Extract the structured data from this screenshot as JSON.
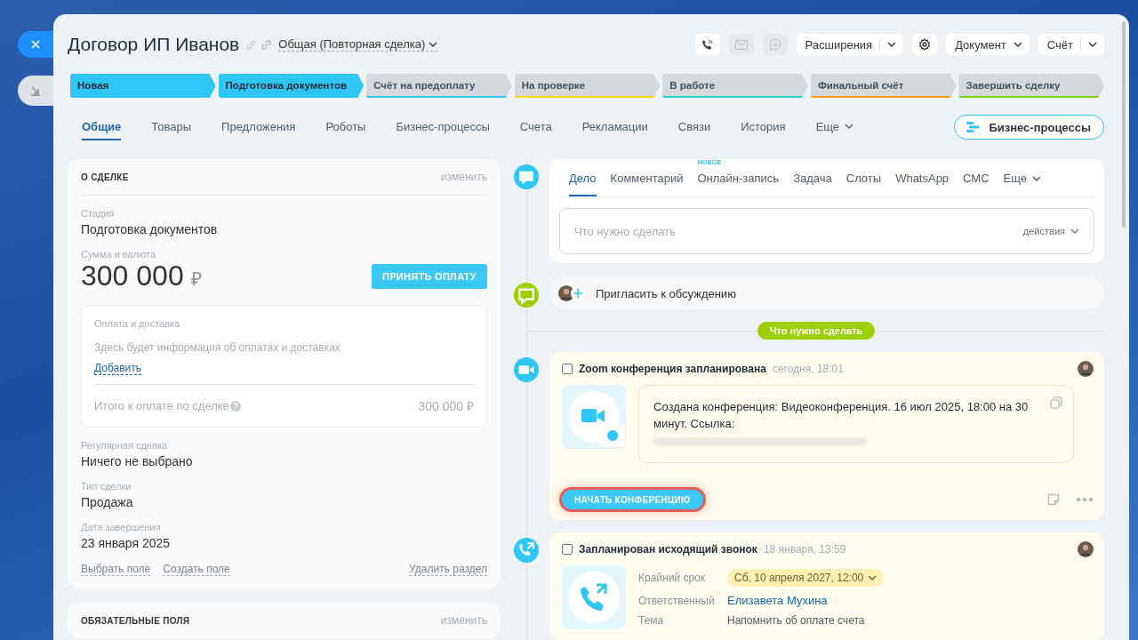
{
  "header": {
    "title": "Договор ИП Иванов",
    "category": "Общая (Повторная сделка)",
    "icon_buttons": [
      {
        "kind": "phone",
        "disabled": false
      },
      {
        "kind": "mail",
        "disabled": true
      },
      {
        "kind": "chat",
        "disabled": true
      }
    ],
    "buttons": [
      {
        "kind": "split",
        "label": "Расширения"
      },
      {
        "kind": "gear"
      },
      {
        "kind": "dropdown",
        "label": "Документ"
      },
      {
        "kind": "split",
        "label": "Счёт"
      }
    ]
  },
  "stages": [
    {
      "label": "Новая",
      "color": "#2fc6f6",
      "reached": true
    },
    {
      "label": "Подготовка документов",
      "color": "#2fc6f6",
      "reached": true
    },
    {
      "label": "Счёт на предоплату",
      "color": "#2fc6f6",
      "reached": false
    },
    {
      "label": "На проверке",
      "color": "#ffd900",
      "reached": false
    },
    {
      "label": "В работе",
      "color": "#1ed6c6",
      "reached": false
    },
    {
      "label": "Финальный счёт",
      "color": "#ff9a1f",
      "reached": false
    },
    {
      "label": "Завершить сделку",
      "color": "#7bd500",
      "reached": false
    }
  ],
  "tabs": [
    {
      "label": "Общие",
      "selected": true
    },
    {
      "label": "Товары",
      "selected": false
    },
    {
      "label": "Предложения",
      "selected": false
    },
    {
      "label": "Роботы",
      "selected": false
    },
    {
      "label": "Бизнес-процессы",
      "selected": false
    },
    {
      "label": "Счета",
      "selected": false
    },
    {
      "label": "Рекламации",
      "selected": false
    },
    {
      "label": "Связи",
      "selected": false
    },
    {
      "label": "История",
      "selected": false
    },
    {
      "label": "Еще",
      "selected": false,
      "kind": "more"
    }
  ],
  "process_button": "Бизнес-процессы",
  "deal_card": {
    "title": "О СДЕЛКЕ",
    "edit": "изменить",
    "stage": {
      "label": "Стадия",
      "value": "Подготовка документов"
    },
    "amount": {
      "label": "Сумма и валюта",
      "value": "300 000",
      "currency": "₽",
      "button": "ПРИНЯТЬ ОПЛАТУ"
    },
    "payment": {
      "title": "Оплата и доставка",
      "text": "Здесь будет информация об оплатах и доставках",
      "add": "Добавить",
      "total_label": "Итого к оплате по сделке",
      "total": "300 000 ₽"
    },
    "fields": [
      {
        "label": "Регулярная сделка",
        "value": "Ничего не выбрано"
      },
      {
        "label": "Тип сделки",
        "value": "Продажа"
      },
      {
        "label": "Дата завершения",
        "value": "23 января 2025"
      }
    ],
    "links": [
      "Выбрать поле",
      "Создать поле"
    ],
    "delete_link": "Удалить раздел"
  },
  "required_card": {
    "title": "ОБЯЗАТЕЛЬНЫЕ ПОЛЯ",
    "edit": "изменить"
  },
  "editor": {
    "tabs": [
      {
        "label": "Дело",
        "selected": true
      },
      {
        "label": "Комментарий",
        "selected": false
      },
      {
        "label": "Онлайн-запись",
        "selected": false,
        "badge": "НОВОЕ"
      },
      {
        "label": "Задача",
        "selected": false
      },
      {
        "label": "Слоты",
        "selected": false
      },
      {
        "label": "WhatsApp",
        "selected": false
      },
      {
        "label": "СМС",
        "selected": false
      },
      {
        "label": "Еще",
        "selected": false,
        "kind": "more"
      }
    ],
    "placeholder": "Что нужно сделать",
    "actions": "действия"
  },
  "invite": "Пригласить к обсуждению",
  "section_label": "Что нужно сделать",
  "activities": [
    {
      "kind": "zoom",
      "checked": false,
      "title": "Zoom конференция запланирована",
      "time": "сегодня, 18:01",
      "text": "Создана конференция: Видеоконференция. 16 июл 2025, 18:00 на 30 минут. Ссылка:",
      "button": "НАЧАТЬ КОНФЕРЕНЦИЮ",
      "highlighted": true
    },
    {
      "kind": "call",
      "checked": false,
      "title": "Запланирован исходящий звонок",
      "time": "18 января, 13:59",
      "rows": [
        {
          "kind": "date",
          "label": "Крайний срок",
          "value": "Сб, 10 апреля 2027, 12:00"
        },
        {
          "kind": "person",
          "label": "Ответственный",
          "value": "Елизавета Мухина"
        },
        {
          "kind": "text",
          "label": "Тема",
          "value": "Напомнить об оплате счета"
        }
      ]
    }
  ]
}
